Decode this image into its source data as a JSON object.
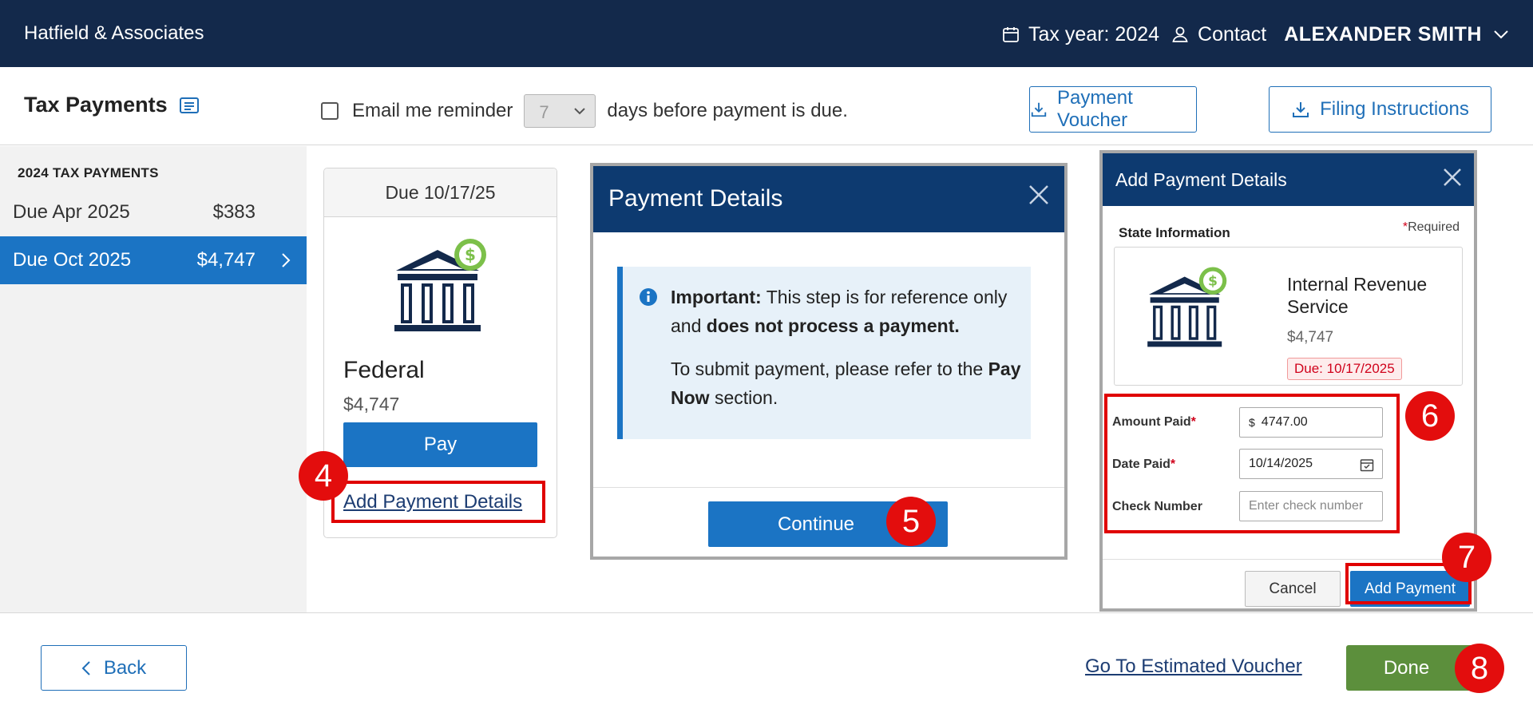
{
  "header": {
    "brand": "Hatfield & Associates",
    "tax_year": "Tax year: 2024",
    "contact": "Contact",
    "user": "ALEXANDER SMITH"
  },
  "subheader": {
    "title": "Tax Payments",
    "reminder_prefix": "Email me reminder",
    "reminder_days": "7",
    "reminder_suffix": "days before payment is due.",
    "payment_voucher": "Payment Voucher",
    "filing_instructions": "Filing Instructions"
  },
  "sidebar": {
    "section_title": "2024 TAX PAYMENTS",
    "items": [
      {
        "label": "Due Apr 2025",
        "amount": "$383"
      },
      {
        "label": "Due Oct 2025",
        "amount": "$4,747"
      }
    ]
  },
  "due_card": {
    "header": "Due 10/17/25",
    "name": "Federal",
    "amount": "$4,747",
    "pay_label": "Pay",
    "add_details_link": "Add Payment Details"
  },
  "payment_details_modal": {
    "title": "Payment Details",
    "important_label": "Important:",
    "important_text": " This step is for reference only and ",
    "important_bold": "does not process a payment.",
    "submit_text": "To submit payment, please refer to the ",
    "submit_bold": "Pay Now",
    "submit_suffix": " section.",
    "continue_label": "Continue"
  },
  "add_payment_modal": {
    "title": "Add Payment Details",
    "section_label": "State Information",
    "required_label": "Required",
    "agency_name": "Internal Revenue Service",
    "agency_amount": "$4,747",
    "due_badge": "Due: 10/17/2025",
    "amount_paid_label": "Amount Paid",
    "amount_paid_value": "4747.00",
    "currency_symbol": "$",
    "date_paid_label": "Date Paid",
    "date_paid_value": "10/14/2025",
    "check_number_label": "Check Number",
    "check_number_placeholder": "Enter check number",
    "cancel_label": "Cancel",
    "add_payment_label": "Add Payment"
  },
  "footer": {
    "back_label": "Back",
    "voucher_link": "Go To Estimated Voucher",
    "done_label": "Done"
  },
  "step_badges": [
    "4",
    "5",
    "6",
    "7",
    "8"
  ],
  "colors": {
    "navy": "#13294b",
    "modal_navy": "#0d3a70",
    "primary_blue": "#1b74c4",
    "done_green": "#5c8f3c",
    "callout_red": "#e00000",
    "dollar_green": "#7cc04a"
  }
}
